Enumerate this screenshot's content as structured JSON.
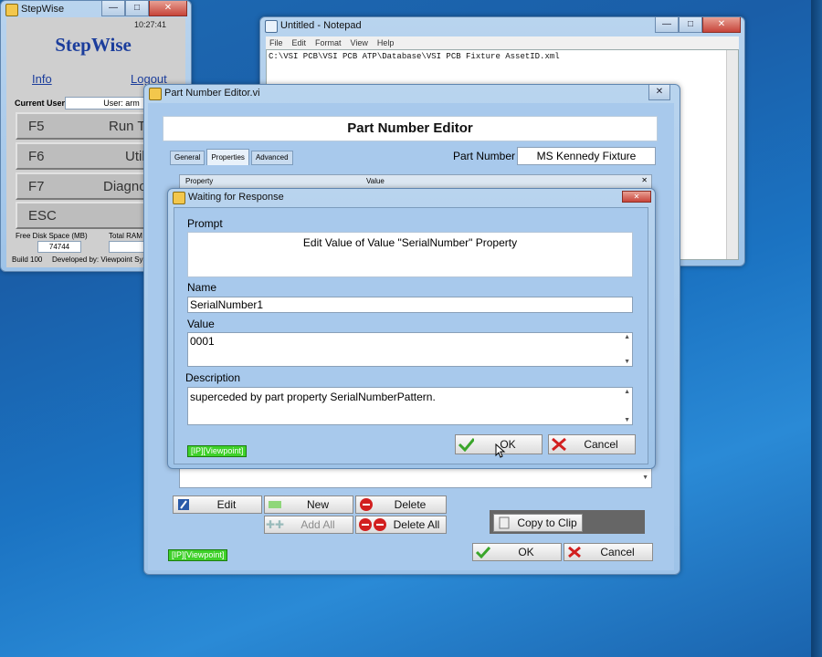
{
  "stepwise": {
    "title": "StepWise",
    "time": "10:27:41",
    "app_name": "StepWise",
    "info": "Info",
    "logout": "Logout",
    "current_user_label": "Current User",
    "user_value": "User: arm",
    "keys": [
      {
        "key": "F5",
        "label": "Run Te"
      },
      {
        "key": "F6",
        "label": "Utilit"
      },
      {
        "key": "F7",
        "label": "Diagnost"
      },
      {
        "key": "ESC",
        "label": "E"
      }
    ],
    "disk_label": "Free Disk Space (MB)",
    "disk_value": "74744",
    "ram_label": "Total RAM (",
    "build": "Build  100",
    "developed": "Developed by: Viewpoint Syst"
  },
  "notepad": {
    "title": "Untitled - Notepad",
    "menu": [
      "File",
      "Edit",
      "Format",
      "View",
      "Help"
    ],
    "content": "C:\\VSI PCB\\VSI PCB ATP\\Database\\VSI PCB Fixture AssetID.xml"
  },
  "pne": {
    "title": "Part Number Editor.vi",
    "heading": "Part Number Editor",
    "tabs": [
      "General",
      "Properties",
      "Advanced"
    ],
    "part_number_label": "Part Number",
    "part_number_value": "MS Kennedy Fixture",
    "col_property": "Property",
    "col_value": "Value",
    "edit": "Edit",
    "new": "New",
    "delete": "Delete",
    "add_all": "Add All",
    "delete_all": "Delete All",
    "copy_clip": "Copy to Clip",
    "ok": "OK",
    "cancel": "Cancel",
    "tag": "[IP][Viewpoint]"
  },
  "dialog": {
    "title": "Waiting for Response",
    "prompt_label": "Prompt",
    "prompt_text": "Edit Value of Value \"SerialNumber\" Property",
    "name_label": "Name",
    "name_value": "SerialNumber1",
    "value_label": "Value",
    "value_value": "0001",
    "desc_label": "Description",
    "desc_value": "superceded by part property SerialNumberPattern.",
    "ok": "OK",
    "cancel": "Cancel",
    "tag": "[IP][Viewpoint]"
  },
  "colors": {
    "accent": "#1a5ea8",
    "panel": "#9ec3e8",
    "ok_green": "#3aa52a",
    "cancel_red": "#d21f1f"
  }
}
